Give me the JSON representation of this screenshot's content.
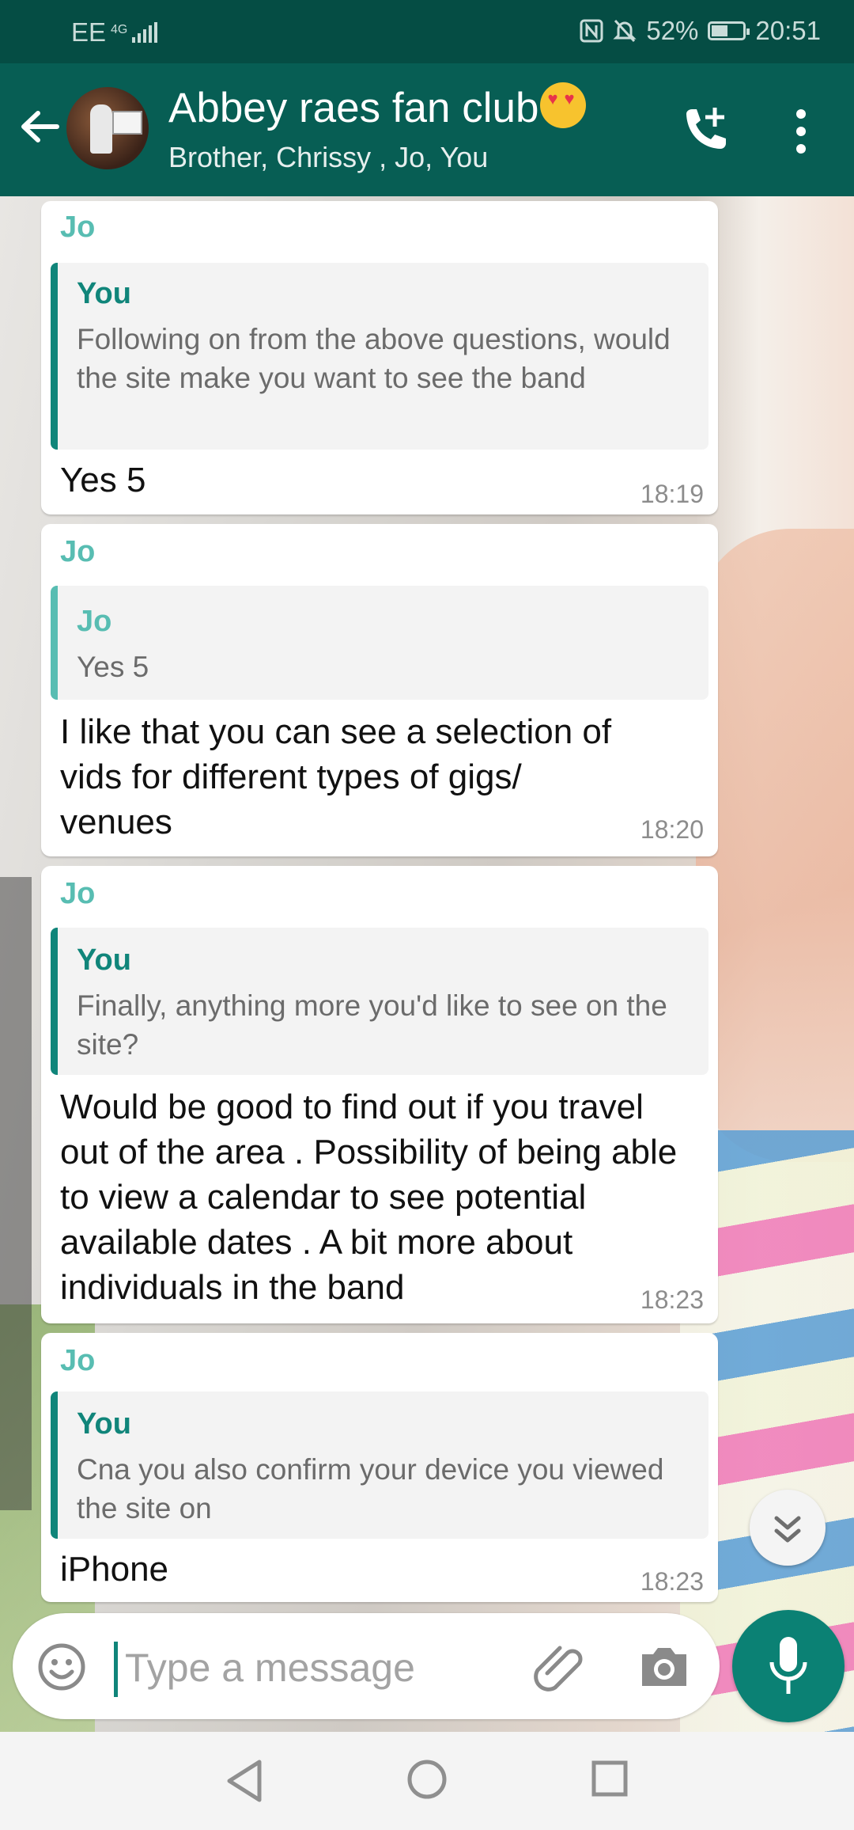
{
  "status_bar": {
    "carrier": "EE",
    "network": "4G",
    "battery": "52%",
    "battery_level": 0.52,
    "time": "20:51"
  },
  "header": {
    "title": "Abbey raes fan club",
    "title_emoji": "smiling-face-with-heart-eyes",
    "members": "Brother, Chrissy , Jo, You"
  },
  "messages": [
    {
      "sender": "Jo",
      "quote": {
        "name": "You",
        "text": "Following on from the above questions, would the site make you want to see the band"
      },
      "text": "Yes 5",
      "time": "18:19"
    },
    {
      "sender": "Jo",
      "quote": {
        "name": "Jo",
        "text": "Yes 5"
      },
      "text": "I like that you can see a selection of vids for different types of gigs/ venues",
      "time": "18:20"
    },
    {
      "sender": "Jo",
      "quote": {
        "name": "You",
        "text": "Finally, anything more you'd like to see on the site?"
      },
      "text": "Would be good to find out if you travel out of the area . Possibility of being able to view a calendar to see potential available dates . A bit more about individuals in the band",
      "time": "18:23"
    },
    {
      "sender": "Jo",
      "quote": {
        "name": "You",
        "text": "Cna you also confirm your device you viewed the site on"
      },
      "text": "iPhone",
      "time": "18:23"
    }
  ],
  "composer": {
    "placeholder": "Type a message",
    "value": ""
  },
  "colors": {
    "header": "#075e54",
    "status_bar": "#054d44",
    "accent": "#0b8174",
    "sender_name": "#58bdb2"
  },
  "icons": [
    "back-arrow-icon",
    "add-call-icon",
    "more-vert-icon",
    "emoji-icon",
    "attach-icon",
    "camera-icon",
    "mic-icon",
    "scroll-down-icon",
    "nav-back-icon",
    "nav-home-icon",
    "nav-recent-icon"
  ]
}
